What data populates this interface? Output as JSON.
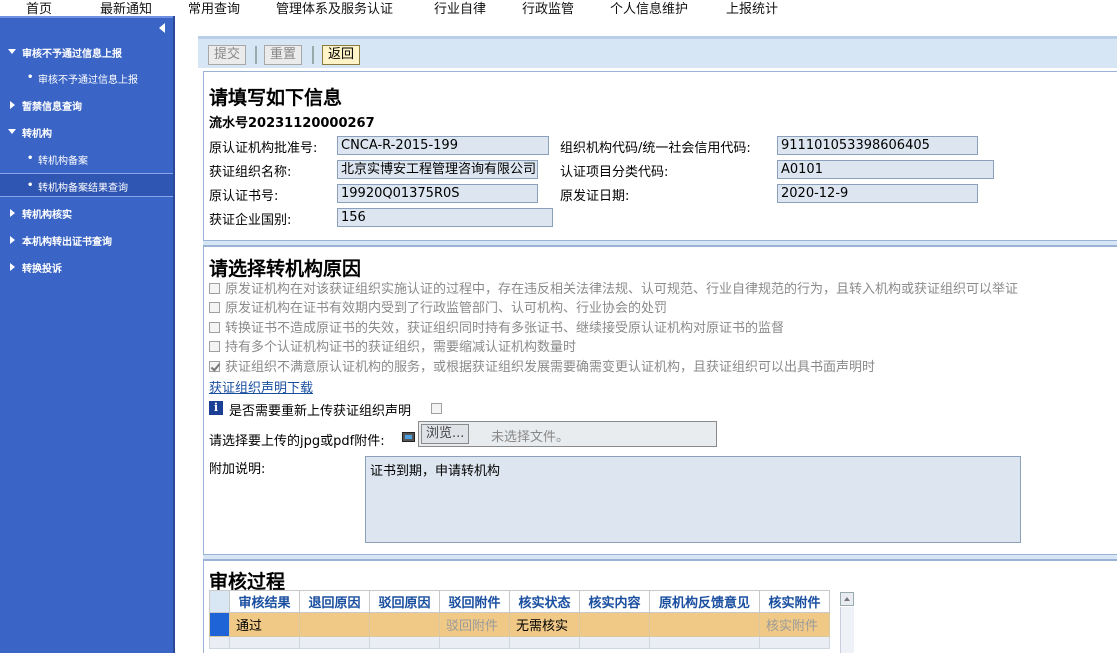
{
  "topnav": {
    "items": [
      "首页",
      "最新通知",
      "常用查询",
      "管理体系及服务认证",
      "行业自律",
      "行政监管",
      "个人信息维护",
      "上报统计"
    ]
  },
  "sidebar": {
    "items": [
      {
        "label": "审核不予通过信息上报",
        "expanded": true
      },
      {
        "label": "审核不予通过信息上报",
        "sub": true
      },
      {
        "label": "暂禁信息查询"
      },
      {
        "label": "转机构",
        "expanded": true
      },
      {
        "label": "转机构备案",
        "sub": true
      },
      {
        "label": "转机构备案结果查询",
        "sub": true,
        "active": true
      },
      {
        "label": "转机构核实"
      },
      {
        "label": "本机构转出证书查询"
      },
      {
        "label": "转换投诉"
      }
    ]
  },
  "toolbar": {
    "submit": "提交",
    "reset": "重置",
    "back": "返回"
  },
  "info": {
    "title": "请填写如下信息",
    "serial": "流水号20231120000267",
    "approval_no_label": "原认证机构批准号:",
    "approval_no": "CNCA-R-2015-199",
    "org_code_label": "组织机构代码/统一社会信用代码:",
    "org_code": "911101053398606405",
    "org_name_label": "获证组织名称:",
    "org_name": "北京实博安工程管理咨询有限公司",
    "category_label": "认证项目分类代码:",
    "category": "A0101",
    "cert_no_label": "原认证书号:",
    "cert_no": "19920Q01375R0S",
    "issue_date_label": "原发证日期:",
    "issue_date": "2020-12-9",
    "country_label": "获证企业国别:",
    "country": "156"
  },
  "reasons": {
    "title": "请选择转机构原因",
    "items": [
      {
        "text": "原发证机构在对该获证组织实施认证的过程中，存在违反相关法律法规、认可规范、行业自律规范的行为，且转入机构或获证组织可以举证",
        "checked": false
      },
      {
        "text": "原发证机构在证书有效期内受到了行政监管部门、认可机构、行业协会的处罚",
        "checked": false
      },
      {
        "text": "转换证书不造成原证书的失效，获证组织同时持有多张证书、继续接受原认证机构对原证书的监督",
        "checked": false
      },
      {
        "text": "持有多个认证机构证书的获证组织，需要缩减认证机构数量时",
        "checked": false
      },
      {
        "text": "获证组织不满意原认证机构的服务，或根据获证组织发展需要确需变更认证机构，且获证组织可以出具书面声明时",
        "checked": true
      }
    ],
    "download_link": "获证组织声明下载",
    "reupload_label": "是否需要重新上传获证组织声明",
    "upload_label": "请选择要上传的jpg或pdf附件:",
    "browse": "浏览...",
    "no_file": "未选择文件。",
    "remark_label": "附加说明:",
    "remark": "证书到期，申请转机构"
  },
  "audit": {
    "title": "审核过程",
    "columns": [
      "审核结果",
      "退回原因",
      "驳回原因",
      "驳回附件",
      "核实状态",
      "核实内容",
      "原机构反馈意见",
      "核实附件"
    ],
    "row": [
      "通过",
      "",
      "",
      "驳回附件",
      "无需核实",
      "",
      "",
      "核实附件"
    ]
  },
  "colors": {
    "sidebar": "#3a64c5",
    "toolbar": "#d7e6f5",
    "row_selected": "#f0c987",
    "header_text": "#1a4fa0"
  }
}
